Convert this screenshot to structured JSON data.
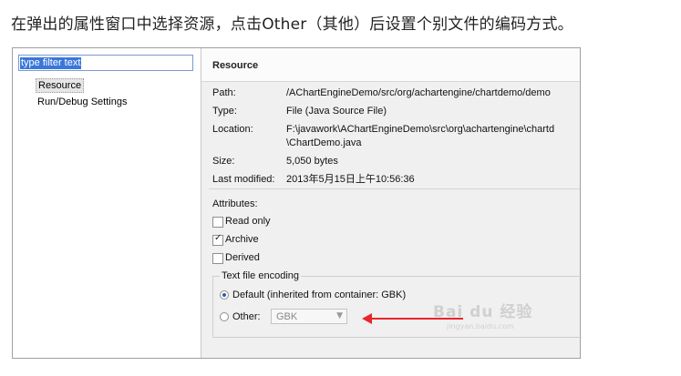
{
  "caption": "在弹出的属性窗口中选择资源，点击Other（其他）后设置个别文件的编码方式。",
  "left_pane": {
    "filter_placeholder": "type filter text",
    "tree": [
      "Resource",
      "Run/Debug Settings"
    ]
  },
  "resource": {
    "title": "Resource",
    "path_label": "Path:",
    "path_value": "/AChartEngineDemo/src/org/achartengine/chartdemo/demo",
    "type_label": "Type:",
    "type_value": "File  (Java Source File)",
    "location_label": "Location:",
    "location_value_1": "F:\\javawork\\AChartEngineDemo\\src\\org\\achartengine\\chartd",
    "location_value_2": "\\ChartDemo.java",
    "size_label": "Size:",
    "size_value": "5,050  bytes",
    "modified_label": "Last modified:",
    "modified_value": "2013年5月15日上午10:56:36",
    "attributes_label": "Attributes:",
    "attributes": [
      {
        "label": "Read only",
        "checked": false
      },
      {
        "label": "Archive",
        "checked": true
      },
      {
        "label": "Derived",
        "checked": false
      }
    ],
    "encoding": {
      "group_title": "Text file encoding",
      "default_label": "Default (inherited from container: GBK)",
      "other_label": "Other:",
      "other_value": "GBK",
      "selected": "default"
    }
  },
  "watermark": {
    "text": "Bai du 经验",
    "sub": "jingyan.baidu.com"
  },
  "colors": {
    "arrow": "#e8262c",
    "selection": "#3a77d9"
  }
}
